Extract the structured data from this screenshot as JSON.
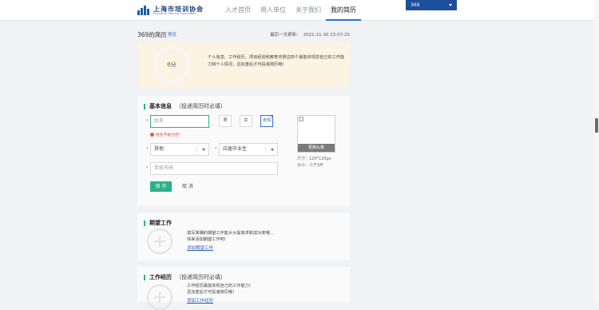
{
  "header": {
    "logo_cn": "上海市培训协会",
    "logo_en": "Shanghai Training Association",
    "nav": [
      {
        "label": "人才首页"
      },
      {
        "label": "用人单位"
      },
      {
        "label": "关于我们"
      },
      {
        "label": "我的简历"
      }
    ],
    "active_nav": "我的简历",
    "user": "369"
  },
  "resume": {
    "title": "369的简历",
    "preview": "预览",
    "updated_label": "最后一次更新：",
    "updated_time": "2021-11-30 23:07:25"
  },
  "score": {
    "value": "0分",
    "tip": "个人信息、工作经历、项目经验和教育背景这四个最能体现您自己的工作能力和个人情况，且完善后才可投递简历哦！"
  },
  "basic": {
    "title": "基本信息",
    "note": "（投递简历时必填）",
    "name_placeholder": "姓名",
    "name_error": "姓名不能为空!",
    "gender_options": [
      "男",
      "女",
      "未知"
    ],
    "gender_selected": "未知",
    "identity_value": "其他",
    "grad_value": "应届毕业生",
    "phone_placeholder": "手机号码",
    "save": "保 存",
    "cancel": "取 消",
    "photo_change": "更换头像",
    "photo_size": "尺寸：120*120px",
    "photo_max": "大小：小于1M",
    "required_mark": "*"
  },
  "expect": {
    "title": "期望工作",
    "hint1": "填写准确的期望工作能大大提高求职成功率哦…",
    "hint2": "快来添加期望工作吧!",
    "add": "添加期望工作"
  },
  "work": {
    "title": "工作经历",
    "note": "（投递简历时必填）",
    "hint1": "工作经历最能体现自己的工作能力!",
    "hint2": "且完善后才可投递简历哦!",
    "add": "添加工作经历"
  },
  "colors": {
    "accent_green": "#2ab08a",
    "brand_blue": "#1e4f9c",
    "link_blue": "#2d5fb8",
    "score_bg": "#fdf3e3",
    "error_red": "#e0484b"
  }
}
